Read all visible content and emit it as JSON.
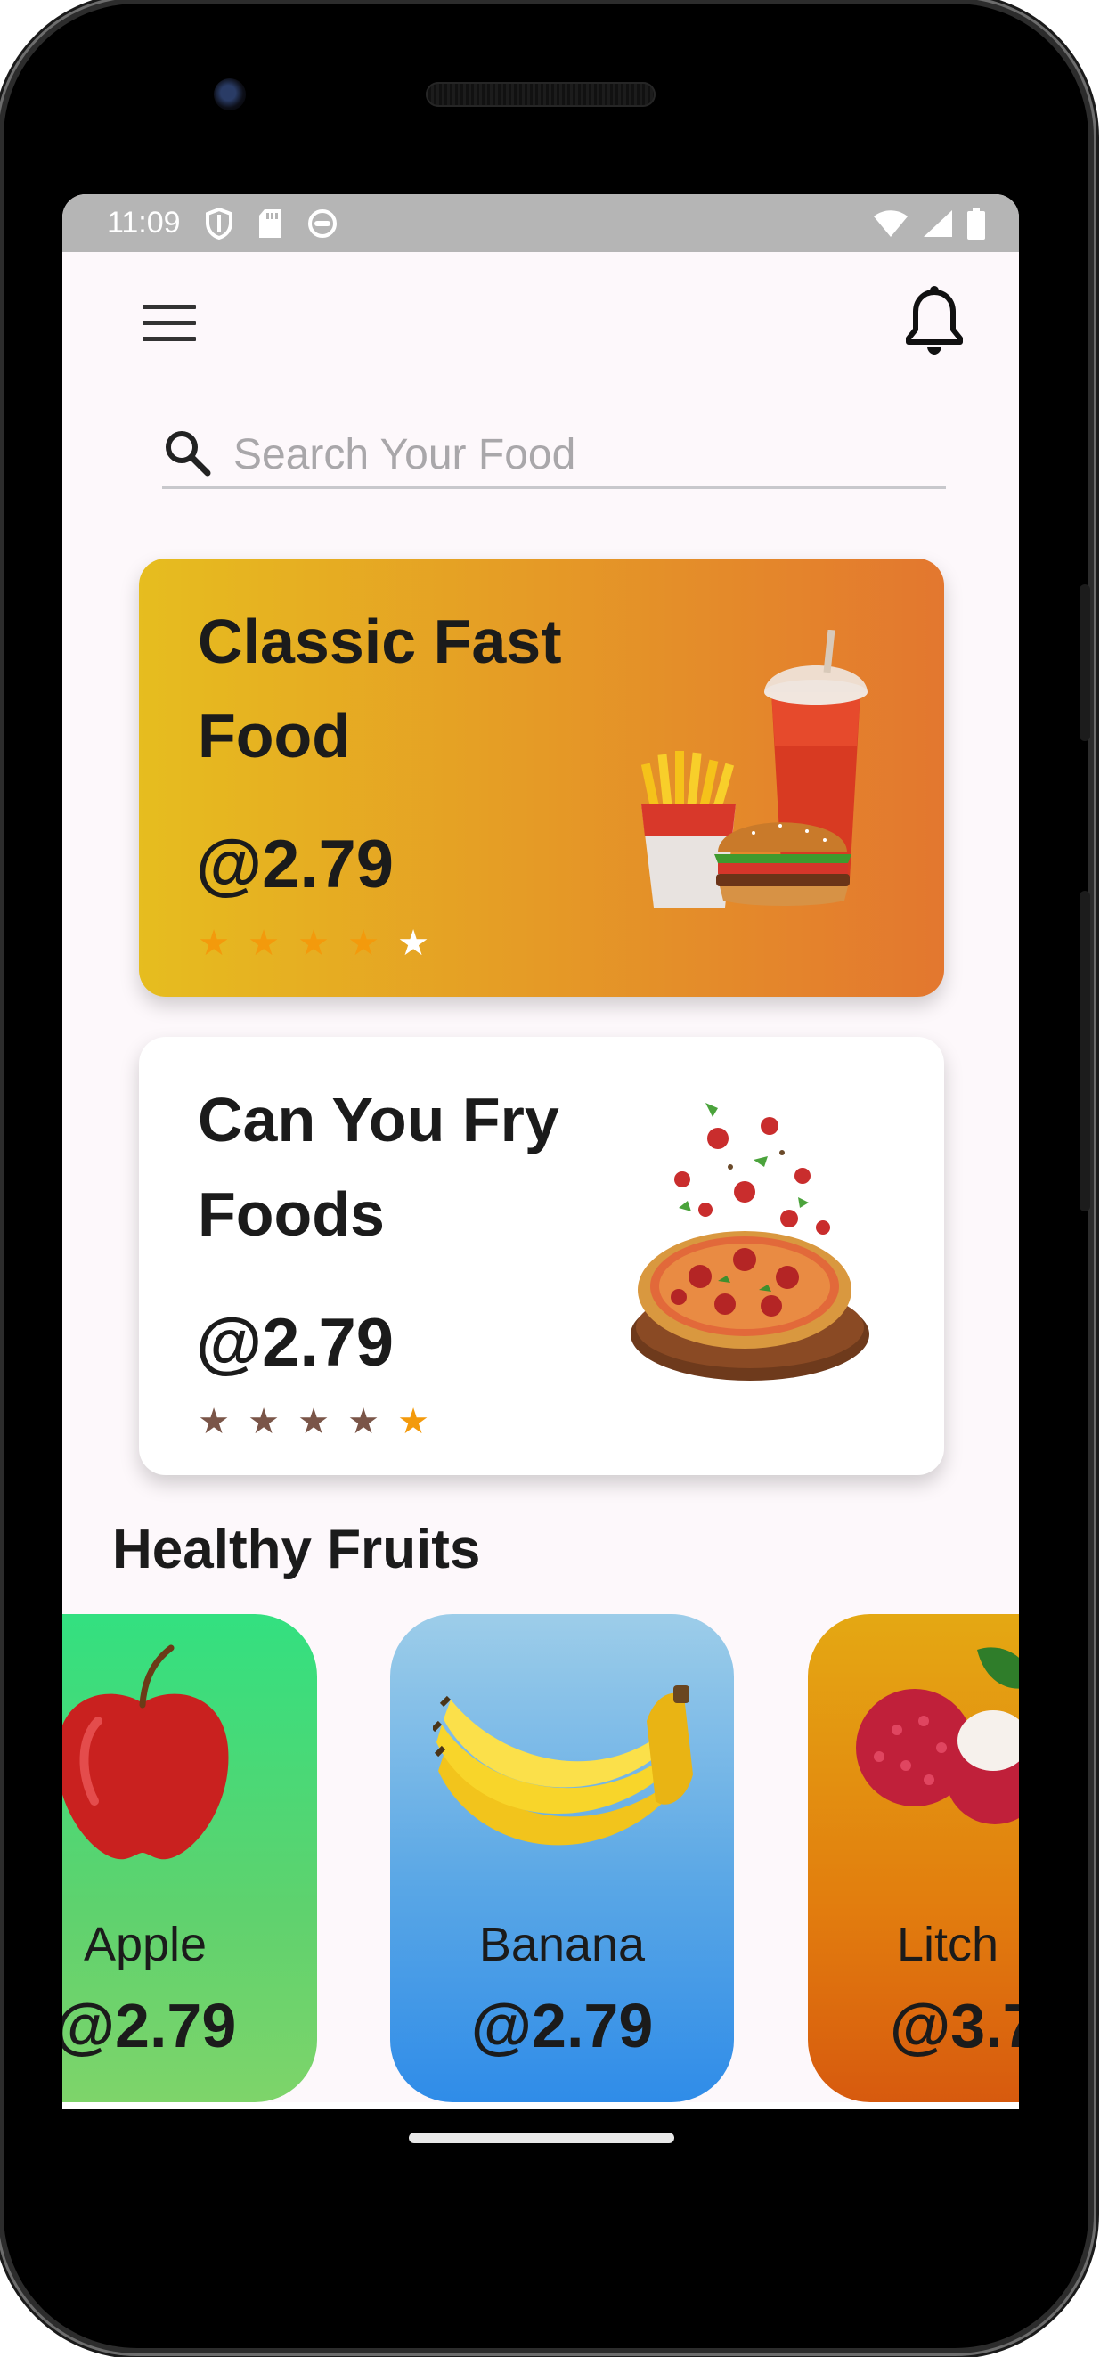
{
  "status_bar": {
    "time": "11:09",
    "left_icons": [
      "shield-icon",
      "sd-card-icon",
      "face-icon"
    ],
    "right_icons": [
      "wifi-icon",
      "signal-icon",
      "battery-icon"
    ]
  },
  "header": {
    "menu_icon": "hamburger-menu-icon",
    "notification_icon": "bell-icon"
  },
  "search": {
    "placeholder": "Search Your Food",
    "value": ""
  },
  "featured": [
    {
      "title": "Classic Fast Food",
      "price": "@2.79",
      "rating": 4,
      "max_rating": 5,
      "image": "burger-fries-soda",
      "filled_star_color": "#f39a0c",
      "empty_star_color": "#ffffff"
    },
    {
      "title": "Can You Fry Foods",
      "price": "@2.79",
      "rating": 1,
      "max_rating": 5,
      "image": "pizza",
      "filled_star_color": "#f39a0c",
      "empty_star_color": "#7a5548"
    }
  ],
  "section": {
    "title": "Healthy Fruits"
  },
  "fruits": [
    {
      "name": "Apple",
      "price": "@2.79",
      "image": "apple"
    },
    {
      "name": "Banana",
      "price": "@2.79",
      "image": "banana"
    },
    {
      "name": "Litch",
      "price": "@3.7",
      "image": "lychee"
    }
  ]
}
